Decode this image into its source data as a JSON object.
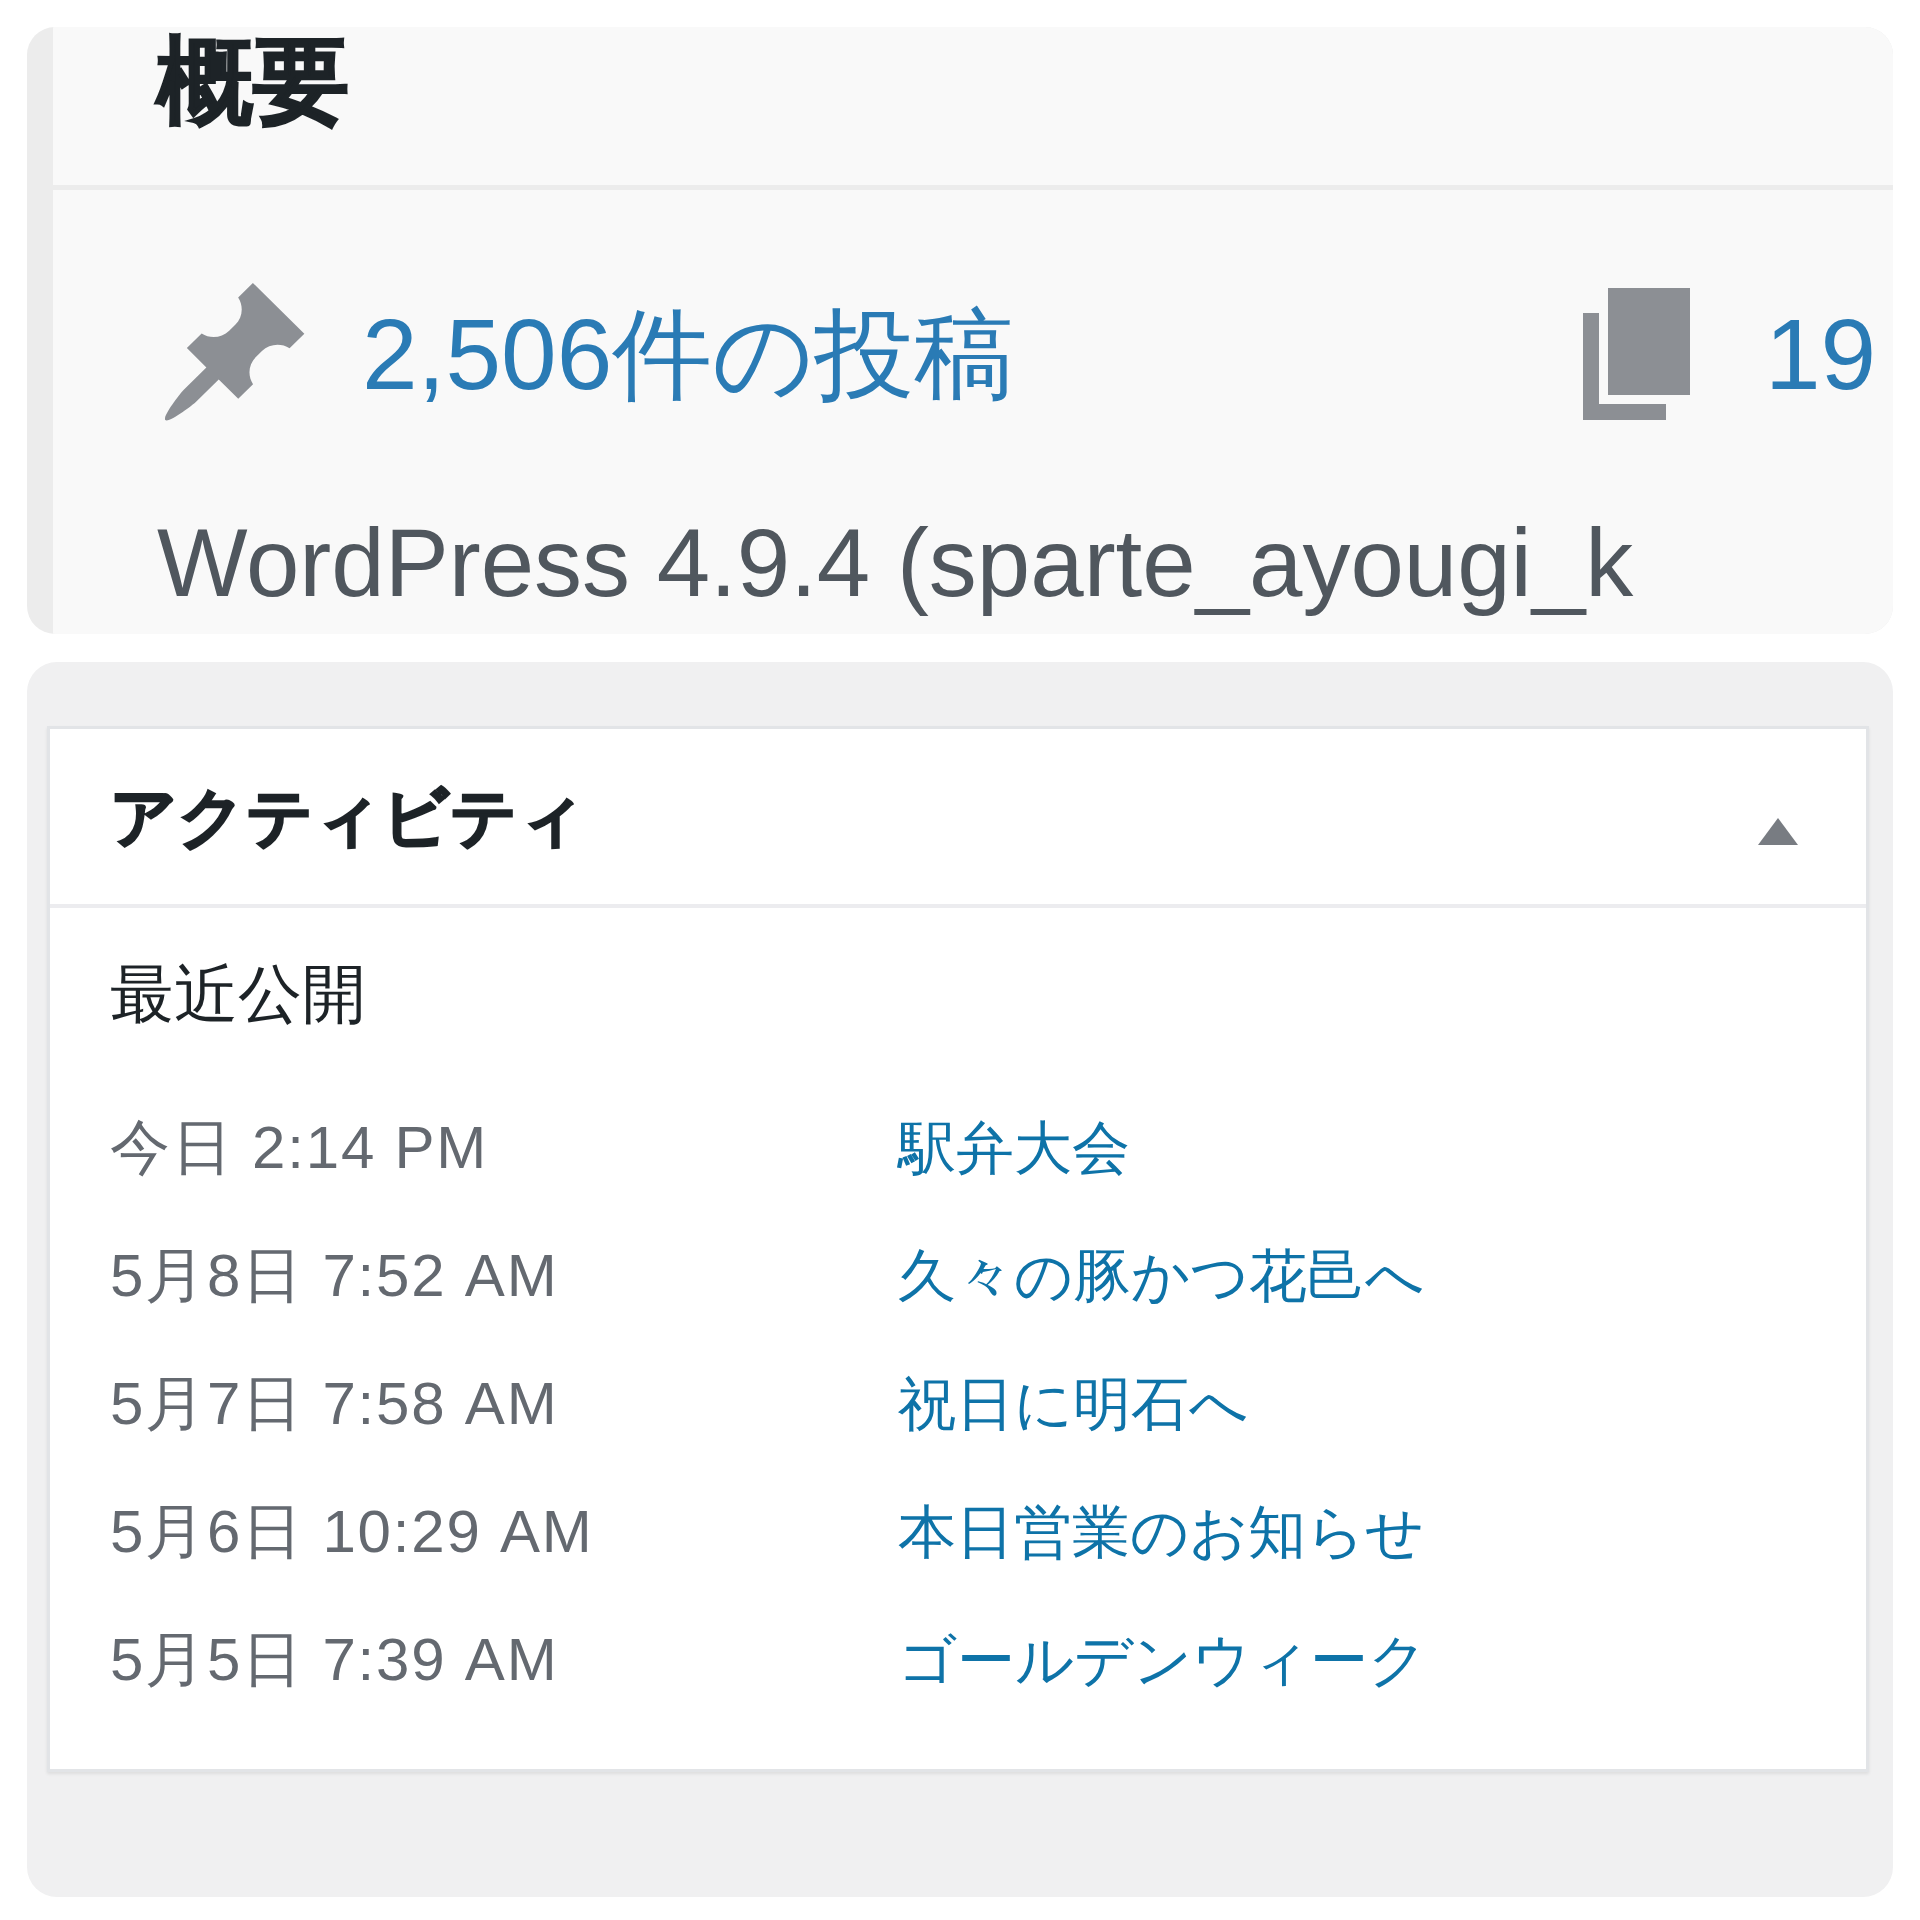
{
  "overview": {
    "title": "概要",
    "stats": [
      {
        "kind": "posts",
        "label": "2,506件の投稿"
      },
      {
        "kind": "pages",
        "label": "19"
      }
    ],
    "version_line": "WordPress 4.9.4 (sparte_ayougi_k"
  },
  "activity": {
    "title": "アクティビティ",
    "expanded": true,
    "section_title": "最近公開",
    "posts": [
      {
        "date": "今日 2:14 PM",
        "title": "駅弁大会"
      },
      {
        "date": "5月8日 7:52 AM",
        "title": "久々の豚かつ花邑へ"
      },
      {
        "date": "5月7日 7:58 AM",
        "title": "祝日に明石へ"
      },
      {
        "date": "5月6日 10:29 AM",
        "title": "本日営業のお知らせ"
      },
      {
        "date": "5月5日 7:39 AM",
        "title": "ゴールデンウィーク"
      }
    ]
  }
}
